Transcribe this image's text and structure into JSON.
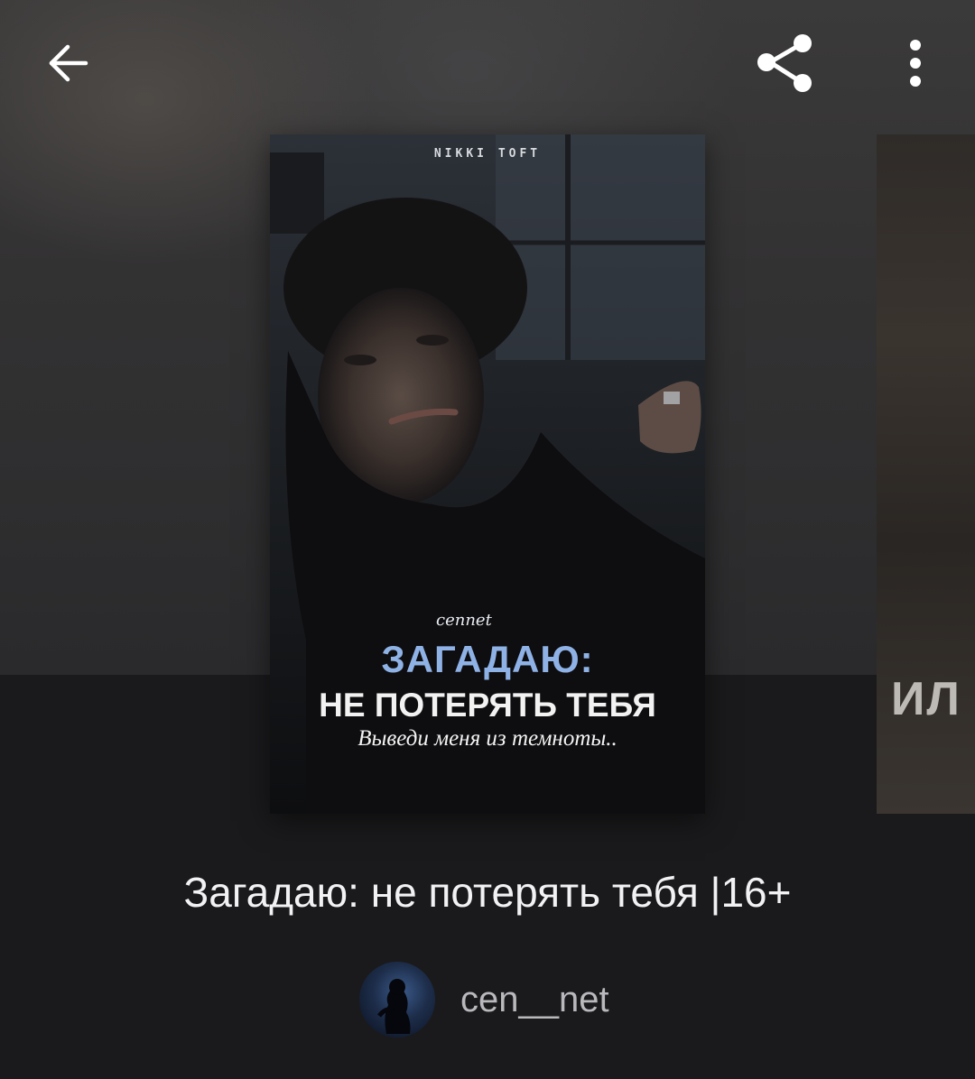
{
  "toolbar": {
    "back_icon": "arrow-left-icon",
    "share_icon": "share-icon",
    "more_icon": "more-vertical-icon"
  },
  "cover": {
    "author_label": "NIKKI TOFT",
    "signature": "cennet",
    "title_line_1": "ЗАГАДАЮ:",
    "title_line_2": "НЕ ПОТЕРЯТЬ ТЕБЯ",
    "tagline": "Выведи меня из темноты.."
  },
  "next_cover": {
    "visible_text": "ИЛ"
  },
  "book": {
    "title": "Загадаю: не потерять тебя |16+",
    "author": "cen__net"
  },
  "colors": {
    "background": "#1b1b1d",
    "title_accent": "#8fb2e6",
    "text_primary": "#f2f2f4",
    "text_secondary": "#b9b9bd"
  }
}
